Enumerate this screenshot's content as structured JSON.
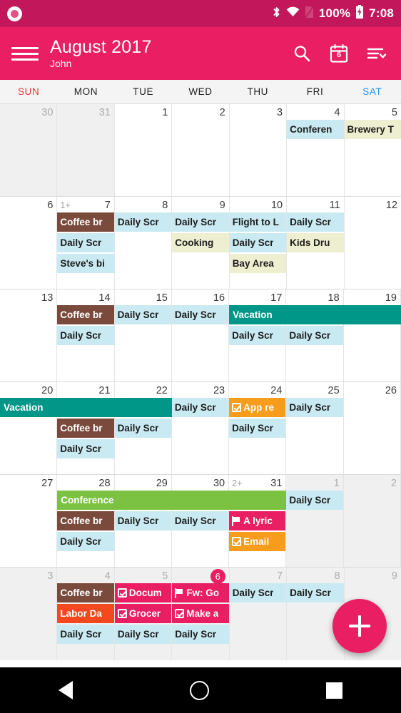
{
  "status_bar": {
    "notification_icon": "circle-notification-icon",
    "bluetooth_icon": "bluetooth-icon",
    "wifi_icon": "wifi-icon",
    "sim_icon": "sim-card-icon",
    "battery_percent": "100%",
    "battery_icon": "battery-charging-icon",
    "time": "7:08"
  },
  "toolbar": {
    "menu_icon": "hamburger-menu-icon",
    "title": "August 2017",
    "subtitle": "John",
    "search_icon": "search-icon",
    "today_icon": "calendar-today-icon",
    "today_icon_number": "6",
    "filter_icon": "filter-sort-icon"
  },
  "weekdays": [
    {
      "label": "SUN",
      "kind": "sun"
    },
    {
      "label": "MON",
      "kind": "weekday"
    },
    {
      "label": "TUE",
      "kind": "weekday"
    },
    {
      "label": "WED",
      "kind": "weekday"
    },
    {
      "label": "THU",
      "kind": "weekday"
    },
    {
      "label": "FRI",
      "kind": "weekday"
    },
    {
      "label": "SAT",
      "kind": "sat"
    }
  ],
  "colors": {
    "brand_primary": "#e91e63",
    "brand_dark": "#c2185b",
    "event_blue": "#c9eaf2",
    "event_yellow": "#eeeed0",
    "event_brown": "#7a4a3c",
    "event_teal": "#009688",
    "event_green": "#7cc242",
    "event_orange": "#f89c1c",
    "event_pink": "#e91e63",
    "event_red": "#f4481f",
    "out_of_month_bg": "#f0f0f0"
  },
  "fab": {
    "icon": "plus-icon",
    "label": "Add event"
  },
  "navbar": {
    "back_icon": "back-triangle-icon",
    "home_icon": "home-circle-icon",
    "recents_icon": "recents-square-icon"
  },
  "calendar": {
    "weeks": [
      {
        "spans": [],
        "days": [
          {
            "num": "30",
            "out": true,
            "today": false,
            "more": "",
            "events": []
          },
          {
            "num": "31",
            "out": true,
            "today": false,
            "more": "",
            "events": []
          },
          {
            "num": "1",
            "out": false,
            "today": false,
            "more": "",
            "events": []
          },
          {
            "num": "2",
            "out": false,
            "today": false,
            "more": "",
            "events": []
          },
          {
            "num": "3",
            "out": false,
            "today": false,
            "more": "",
            "events": []
          },
          {
            "num": "4",
            "out": false,
            "today": false,
            "more": "",
            "events": [
              {
                "title": "Conferen",
                "bg": "#c9eaf2",
                "fg": "#1c1c1c",
                "icon": ""
              }
            ]
          },
          {
            "num": "5",
            "out": false,
            "today": false,
            "more": "",
            "events": [
              {
                "title": "Brewery T",
                "bg": "#eeeed0",
                "fg": "#1c1c1c",
                "icon": ""
              }
            ]
          }
        ]
      },
      {
        "spans": [],
        "days": [
          {
            "num": "6",
            "out": false,
            "today": false,
            "more": "",
            "events": []
          },
          {
            "num": "7",
            "out": false,
            "today": false,
            "more": "1+",
            "events": [
              {
                "title": "Coffee br",
                "bg": "#7a4a3c",
                "fg": "#ffffff",
                "icon": ""
              },
              {
                "title": "Daily Scr",
                "bg": "#c9eaf2",
                "fg": "#1c1c1c",
                "icon": ""
              },
              {
                "title": "Steve's bi",
                "bg": "#c9eaf2",
                "fg": "#1c1c1c",
                "icon": ""
              }
            ]
          },
          {
            "num": "8",
            "out": false,
            "today": false,
            "more": "",
            "events": [
              {
                "title": "Daily Scr",
                "bg": "#c9eaf2",
                "fg": "#1c1c1c",
                "icon": ""
              }
            ]
          },
          {
            "num": "9",
            "out": false,
            "today": false,
            "more": "",
            "events": [
              {
                "title": "Daily Scr",
                "bg": "#c9eaf2",
                "fg": "#1c1c1c",
                "icon": ""
              },
              {
                "title": "Cooking",
                "bg": "#eeeed0",
                "fg": "#1c1c1c",
                "icon": ""
              }
            ]
          },
          {
            "num": "10",
            "out": false,
            "today": false,
            "more": "",
            "events": [
              {
                "title": "Flight to L",
                "bg": "#c9eaf2",
                "fg": "#1c1c1c",
                "icon": ""
              },
              {
                "title": "Daily Scr",
                "bg": "#c9eaf2",
                "fg": "#1c1c1c",
                "icon": ""
              },
              {
                "title": "Bay Area",
                "bg": "#eeeed0",
                "fg": "#1c1c1c",
                "icon": ""
              }
            ]
          },
          {
            "num": "11",
            "out": false,
            "today": false,
            "more": "",
            "events": [
              {
                "title": "Daily Scr",
                "bg": "#c9eaf2",
                "fg": "#1c1c1c",
                "icon": ""
              },
              {
                "title": "Kids Dru",
                "bg": "#eeeed0",
                "fg": "#1c1c1c",
                "icon": ""
              }
            ]
          },
          {
            "num": "12",
            "out": false,
            "today": false,
            "more": "",
            "events": []
          }
        ]
      },
      {
        "spans": [
          {
            "title": "Vacation",
            "bg": "#009688",
            "fg": "#ffffff",
            "start": 4,
            "end": 6,
            "row": 0
          }
        ],
        "days": [
          {
            "num": "13",
            "out": false,
            "today": false,
            "more": "",
            "events": []
          },
          {
            "num": "14",
            "out": false,
            "today": false,
            "more": "",
            "events": [
              {
                "title": "Coffee br",
                "bg": "#7a4a3c",
                "fg": "#ffffff",
                "icon": ""
              },
              {
                "title": "Daily Scr",
                "bg": "#c9eaf2",
                "fg": "#1c1c1c",
                "icon": ""
              }
            ]
          },
          {
            "num": "15",
            "out": false,
            "today": false,
            "more": "",
            "events": [
              {
                "title": "Daily Scr",
                "bg": "#c9eaf2",
                "fg": "#1c1c1c",
                "icon": ""
              }
            ]
          },
          {
            "num": "16",
            "out": false,
            "today": false,
            "more": "",
            "events": [
              {
                "title": "Daily Scr",
                "bg": "#c9eaf2",
                "fg": "#1c1c1c",
                "icon": ""
              }
            ]
          },
          {
            "num": "17",
            "out": false,
            "today": false,
            "more": "",
            "events": [
              {
                "title": "",
                "bg": "transparent",
                "fg": "#1c1c1c",
                "icon": ""
              },
              {
                "title": "Daily Scr",
                "bg": "#c9eaf2",
                "fg": "#1c1c1c",
                "icon": ""
              }
            ]
          },
          {
            "num": "18",
            "out": false,
            "today": false,
            "more": "",
            "events": [
              {
                "title": "",
                "bg": "transparent",
                "fg": "#1c1c1c",
                "icon": ""
              },
              {
                "title": "Daily Scr",
                "bg": "#c9eaf2",
                "fg": "#1c1c1c",
                "icon": ""
              }
            ]
          },
          {
            "num": "19",
            "out": false,
            "today": false,
            "more": "",
            "events": []
          }
        ]
      },
      {
        "spans": [
          {
            "title": "Vacation",
            "bg": "#009688",
            "fg": "#ffffff",
            "start": 0,
            "end": 2,
            "row": 0
          }
        ],
        "days": [
          {
            "num": "20",
            "out": false,
            "today": false,
            "more": "",
            "events": []
          },
          {
            "num": "21",
            "out": false,
            "today": false,
            "more": "",
            "events": [
              {
                "title": "",
                "bg": "transparent",
                "fg": "#1c1c1c",
                "icon": ""
              },
              {
                "title": "Coffee br",
                "bg": "#7a4a3c",
                "fg": "#ffffff",
                "icon": ""
              },
              {
                "title": "Daily Scr",
                "bg": "#c9eaf2",
                "fg": "#1c1c1c",
                "icon": ""
              }
            ]
          },
          {
            "num": "22",
            "out": false,
            "today": false,
            "more": "",
            "events": [
              {
                "title": "",
                "bg": "transparent",
                "fg": "#1c1c1c",
                "icon": ""
              },
              {
                "title": "Daily Scr",
                "bg": "#c9eaf2",
                "fg": "#1c1c1c",
                "icon": ""
              }
            ]
          },
          {
            "num": "23",
            "out": false,
            "today": false,
            "more": "",
            "events": [
              {
                "title": "Daily Scr",
                "bg": "#c9eaf2",
                "fg": "#1c1c1c",
                "icon": ""
              }
            ]
          },
          {
            "num": "24",
            "out": false,
            "today": false,
            "more": "",
            "events": [
              {
                "title": "App re",
                "bg": "#f89c1c",
                "fg": "#ffffff",
                "icon": "checkbox-icon"
              },
              {
                "title": "Daily Scr",
                "bg": "#c9eaf2",
                "fg": "#1c1c1c",
                "icon": ""
              }
            ]
          },
          {
            "num": "25",
            "out": false,
            "today": false,
            "more": "",
            "events": [
              {
                "title": "Daily Scr",
                "bg": "#c9eaf2",
                "fg": "#1c1c1c",
                "icon": ""
              }
            ]
          },
          {
            "num": "26",
            "out": false,
            "today": false,
            "more": "",
            "events": []
          }
        ]
      },
      {
        "spans": [
          {
            "title": "Conference",
            "bg": "#7cc242",
            "fg": "#ffffff",
            "start": 1,
            "end": 4,
            "row": 0
          }
        ],
        "days": [
          {
            "num": "27",
            "out": false,
            "today": false,
            "more": "",
            "events": []
          },
          {
            "num": "28",
            "out": false,
            "today": false,
            "more": "",
            "events": [
              {
                "title": "",
                "bg": "transparent",
                "fg": "#1c1c1c",
                "icon": ""
              },
              {
                "title": "Coffee br",
                "bg": "#7a4a3c",
                "fg": "#ffffff",
                "icon": ""
              },
              {
                "title": "Daily Scr",
                "bg": "#c9eaf2",
                "fg": "#1c1c1c",
                "icon": ""
              }
            ]
          },
          {
            "num": "29",
            "out": false,
            "today": false,
            "more": "",
            "events": [
              {
                "title": "",
                "bg": "transparent",
                "fg": "#1c1c1c",
                "icon": ""
              },
              {
                "title": "Daily Scr",
                "bg": "#c9eaf2",
                "fg": "#1c1c1c",
                "icon": ""
              }
            ]
          },
          {
            "num": "30",
            "out": false,
            "today": false,
            "more": "",
            "events": [
              {
                "title": "",
                "bg": "transparent",
                "fg": "#1c1c1c",
                "icon": ""
              },
              {
                "title": "Daily Scr",
                "bg": "#c9eaf2",
                "fg": "#1c1c1c",
                "icon": ""
              }
            ]
          },
          {
            "num": "31",
            "out": false,
            "today": false,
            "more": "2+",
            "events": [
              {
                "title": "",
                "bg": "transparent",
                "fg": "#1c1c1c",
                "icon": ""
              },
              {
                "title": "A lyric",
                "bg": "#e91e63",
                "fg": "#ffffff",
                "icon": "flag-icon"
              },
              {
                "title": "Email",
                "bg": "#f89c1c",
                "fg": "#ffffff",
                "icon": "checkbox-icon"
              }
            ]
          },
          {
            "num": "1",
            "out": true,
            "today": false,
            "more": "",
            "events": [
              {
                "title": "Daily Scr",
                "bg": "#c9eaf2",
                "fg": "#1c1c1c",
                "icon": ""
              }
            ]
          },
          {
            "num": "2",
            "out": true,
            "today": false,
            "more": "",
            "events": []
          }
        ]
      },
      {
        "spans": [],
        "days": [
          {
            "num": "3",
            "out": true,
            "today": false,
            "more": "",
            "events": []
          },
          {
            "num": "4",
            "out": true,
            "today": false,
            "more": "",
            "events": [
              {
                "title": "Coffee br",
                "bg": "#7a4a3c",
                "fg": "#ffffff",
                "icon": ""
              },
              {
                "title": "Labor Da",
                "bg": "#f4481f",
                "fg": "#ffffff",
                "icon": ""
              },
              {
                "title": "Daily Scr",
                "bg": "#c9eaf2",
                "fg": "#1c1c1c",
                "icon": ""
              }
            ]
          },
          {
            "num": "5",
            "out": true,
            "today": false,
            "more": "",
            "events": [
              {
                "title": "Docum",
                "bg": "#e91e63",
                "fg": "#ffffff",
                "icon": "checkbox-icon"
              },
              {
                "title": "Grocer",
                "bg": "#e91e63",
                "fg": "#ffffff",
                "icon": "checkbox-icon"
              },
              {
                "title": "Daily Scr",
                "bg": "#c9eaf2",
                "fg": "#1c1c1c",
                "icon": ""
              }
            ]
          },
          {
            "num": "6",
            "out": true,
            "today": true,
            "more": "",
            "events": [
              {
                "title": "Fw: Go",
                "bg": "#e91e63",
                "fg": "#ffffff",
                "icon": "flag-icon"
              },
              {
                "title": "Make a",
                "bg": "#e91e63",
                "fg": "#ffffff",
                "icon": "checkbox-icon"
              },
              {
                "title": "Daily Scr",
                "bg": "#c9eaf2",
                "fg": "#1c1c1c",
                "icon": ""
              }
            ]
          },
          {
            "num": "7",
            "out": true,
            "today": false,
            "more": "",
            "events": [
              {
                "title": "Daily Scr",
                "bg": "#c9eaf2",
                "fg": "#1c1c1c",
                "icon": ""
              }
            ]
          },
          {
            "num": "8",
            "out": true,
            "today": false,
            "more": "",
            "events": [
              {
                "title": "Daily Scr",
                "bg": "#c9eaf2",
                "fg": "#1c1c1c",
                "icon": ""
              }
            ]
          },
          {
            "num": "9",
            "out": true,
            "today": false,
            "more": "",
            "events": []
          }
        ]
      }
    ]
  }
}
